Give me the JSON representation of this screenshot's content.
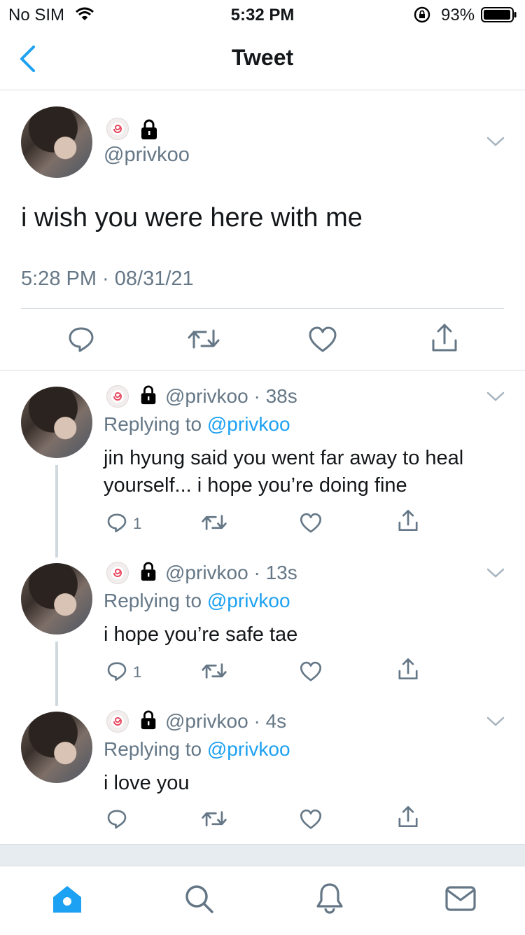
{
  "status_bar": {
    "carrier": "No SIM",
    "time": "5:32 PM",
    "battery_percent": "93%"
  },
  "nav": {
    "title": "Tweet"
  },
  "main_tweet": {
    "handle": "@privkoo",
    "text": "i wish you were here with me",
    "timestamp": "5:28 PM · 08/31/21"
  },
  "replies": [
    {
      "handle": "@privkoo",
      "age": "· 38s",
      "replying_label": "Replying to",
      "replying_handle": "@privkoo",
      "text_line1": "jin hyung said you went far away to heal",
      "text_line2": "yourself... i hope you’re doing fine",
      "reply_count": "1"
    },
    {
      "handle": "@privkoo",
      "age": "· 13s",
      "replying_label": "Replying to",
      "replying_handle": "@privkoo",
      "text_line1": "i hope you’re safe tae",
      "reply_count": "1"
    },
    {
      "handle": "@privkoo",
      "age": "· 4s",
      "replying_label": "Replying to",
      "replying_handle": "@privkoo",
      "text_line1": "i love you"
    }
  ],
  "icons": {
    "status": [
      "wifi-icon",
      "orientation-lock-icon",
      "battery-icon"
    ],
    "nav": [
      "back-chevron-icon"
    ],
    "actions": [
      "reply-icon",
      "retweet-icon",
      "like-icon",
      "share-icon"
    ],
    "tabs": [
      "home-icon",
      "search-icon",
      "notifications-icon",
      "messages-icon"
    ]
  },
  "colors": {
    "accent": "#1da1f2",
    "secondary_text": "#657786",
    "divider": "#d8dde2"
  }
}
